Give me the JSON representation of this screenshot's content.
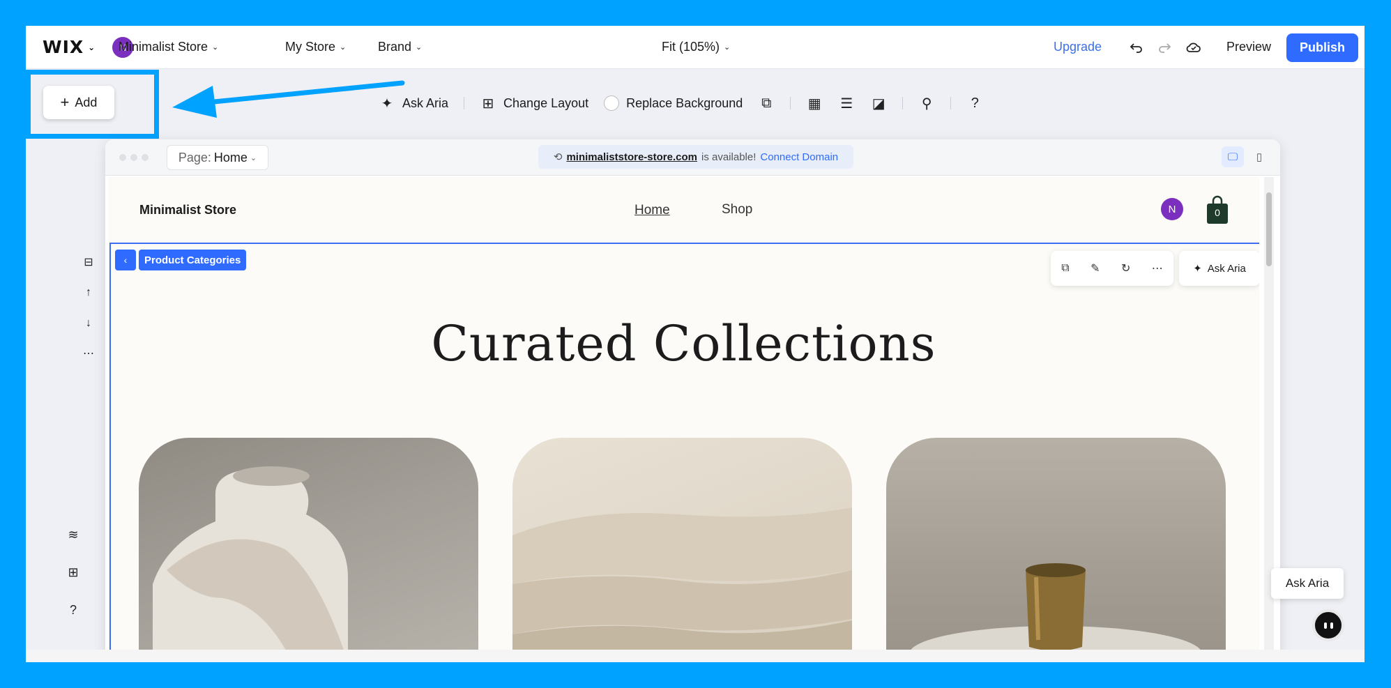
{
  "topbar": {
    "logo": "WIX",
    "avatar_initial": "N",
    "menus": [
      "Minimalist Store",
      "My Store",
      "Brand"
    ],
    "zoom": "Fit (105%)",
    "upgrade": "Upgrade",
    "preview": "Preview",
    "publish": "Publish"
  },
  "add_button": {
    "label": "Add"
  },
  "toolbar": {
    "ask_aria": "Ask Aria",
    "change_layout": "Change Layout",
    "replace_background": "Replace Background",
    "help": "?"
  },
  "browser": {
    "page_prefix": "Page:",
    "page_name": "Home",
    "domain": "minimaliststore-store.com",
    "domain_available": "is available!",
    "connect_domain": "Connect Domain"
  },
  "site": {
    "brand": "Minimalist Store",
    "nav": [
      "Home",
      "Shop"
    ],
    "avatar_initial": "N",
    "cart_count": "0",
    "breadcrumb": "Product Categories",
    "ask_aria": "Ask Aria",
    "heading": "Curated Collections"
  },
  "floating": {
    "ask_aria": "Ask Aria"
  },
  "colors": {
    "accent": "#2f6bff",
    "highlight": "#00a2ff",
    "avatar": "#7b2fbf"
  }
}
